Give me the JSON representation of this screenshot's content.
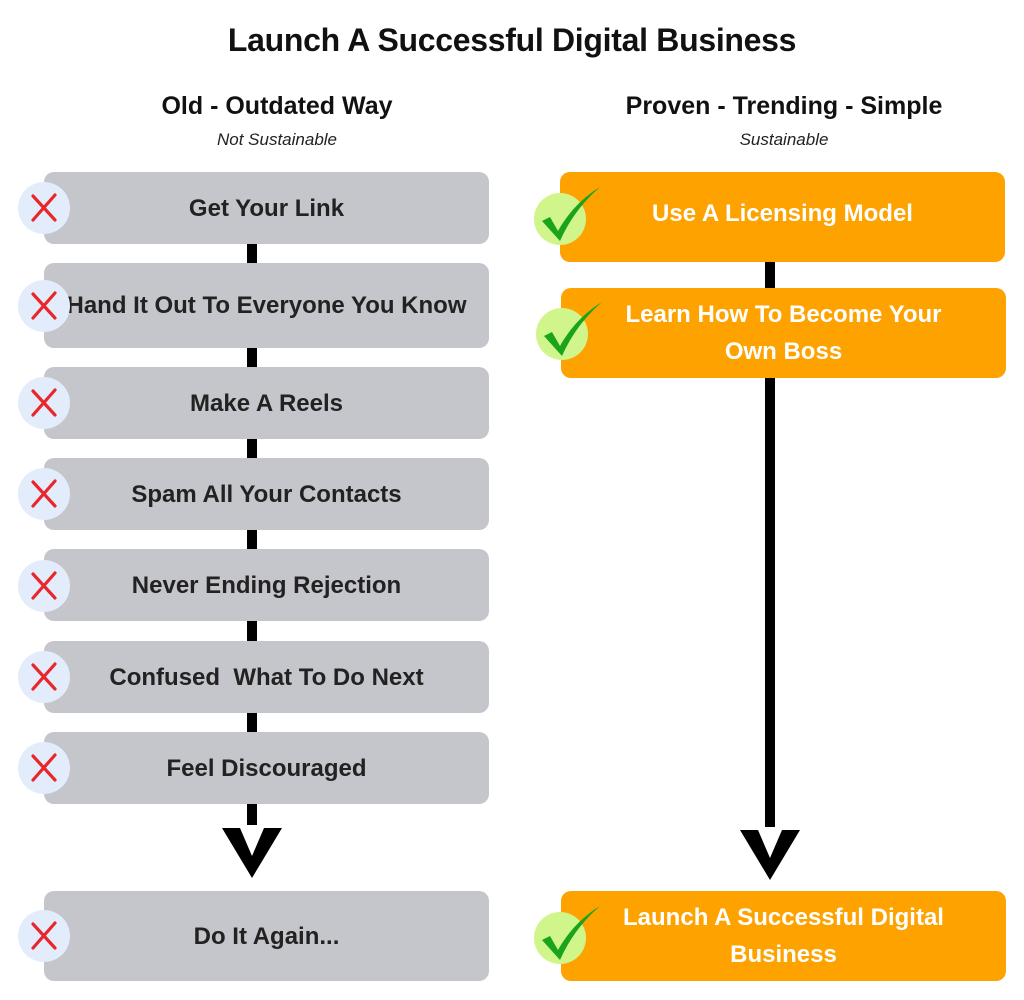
{
  "title": "Launch A Successful Digital Business",
  "columns": {
    "old": {
      "heading": "Old - Outdated Way",
      "subheading": "Not Sustainable",
      "steps": [
        {
          "label": "Get Your Link",
          "status": "x-icon"
        },
        {
          "label": "Hand It Out To Everyone You Know",
          "status": "x-icon"
        },
        {
          "label": "Make A Reels",
          "status": "x-icon"
        },
        {
          "label": "Spam All Your Contacts",
          "status": "x-icon"
        },
        {
          "label": "Never Ending Rejection",
          "status": "x-icon"
        },
        {
          "label": "Confused  What To Do Next",
          "status": "x-icon"
        },
        {
          "label": "Feel Discouraged",
          "status": "x-icon"
        }
      ],
      "result": {
        "label": "Do It Again...",
        "status": "x-icon"
      }
    },
    "new": {
      "heading": "Proven - Trending - Simple",
      "subheading": "Sustainable",
      "steps": [
        {
          "label": "Use A Licensing Model",
          "status": "check-icon"
        },
        {
          "label": "Learn How To Become Your Own Boss",
          "status": "check-icon"
        }
      ],
      "result": {
        "label": "Launch A Successful Digital Business",
        "status": "check-icon"
      }
    }
  },
  "colors": {
    "old_box": "#c5c6cb",
    "new_box": "#fea200",
    "x_mark": "#e8262b",
    "x_badge": "#e3ecfb",
    "check_mark": "#1aa41c",
    "check_badge": "#d0f58b",
    "connector": "#000000"
  }
}
